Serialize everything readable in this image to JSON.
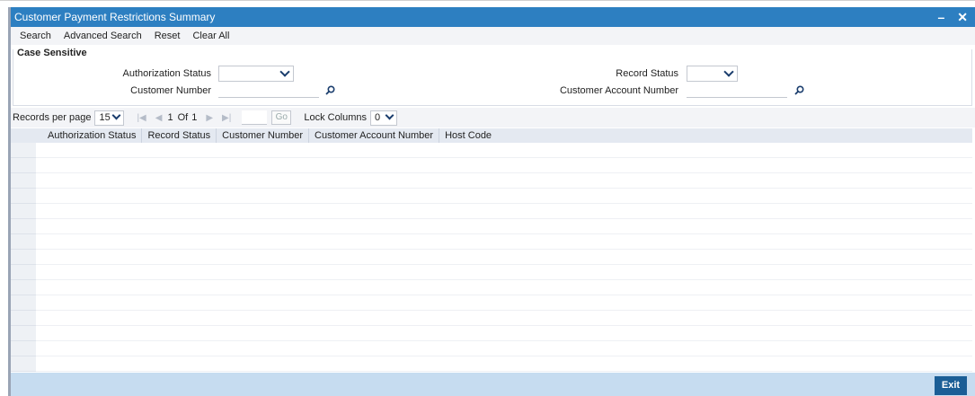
{
  "window": {
    "title": "Customer Payment Restrictions Summary",
    "minimize_glyph": "–",
    "close_glyph": "✕"
  },
  "menu": {
    "items": [
      "Search",
      "Advanced Search",
      "Reset",
      "Clear All"
    ]
  },
  "search_panel": {
    "legend": "Case Sensitive",
    "authorization_status_label": "Authorization Status",
    "authorization_status_value": "",
    "record_status_label": "Record Status",
    "record_status_value": "",
    "customer_number_label": "Customer Number",
    "customer_number_value": "",
    "customer_account_number_label": "Customer Account Number",
    "customer_account_number_value": ""
  },
  "pager": {
    "records_per_page_label": "Records per page",
    "records_per_page_value": "15",
    "current_page": "1",
    "of_label": "Of",
    "total_pages": "1",
    "go_label": "Go",
    "lock_columns_label": "Lock Columns",
    "lock_columns_value": "0"
  },
  "grid": {
    "columns": [
      "Authorization Status",
      "Record Status",
      "Customer Number",
      "Customer Account Number",
      "Host Code"
    ],
    "rows": []
  },
  "footer": {
    "exit_label": "Exit"
  },
  "colors": {
    "titlebar": "#2d7fc1",
    "footer": "#c6dcf0",
    "exit_button": "#1b5e96"
  },
  "icons": {
    "search": "magnifier-icon",
    "dropdown": "chevron-down-icon"
  }
}
